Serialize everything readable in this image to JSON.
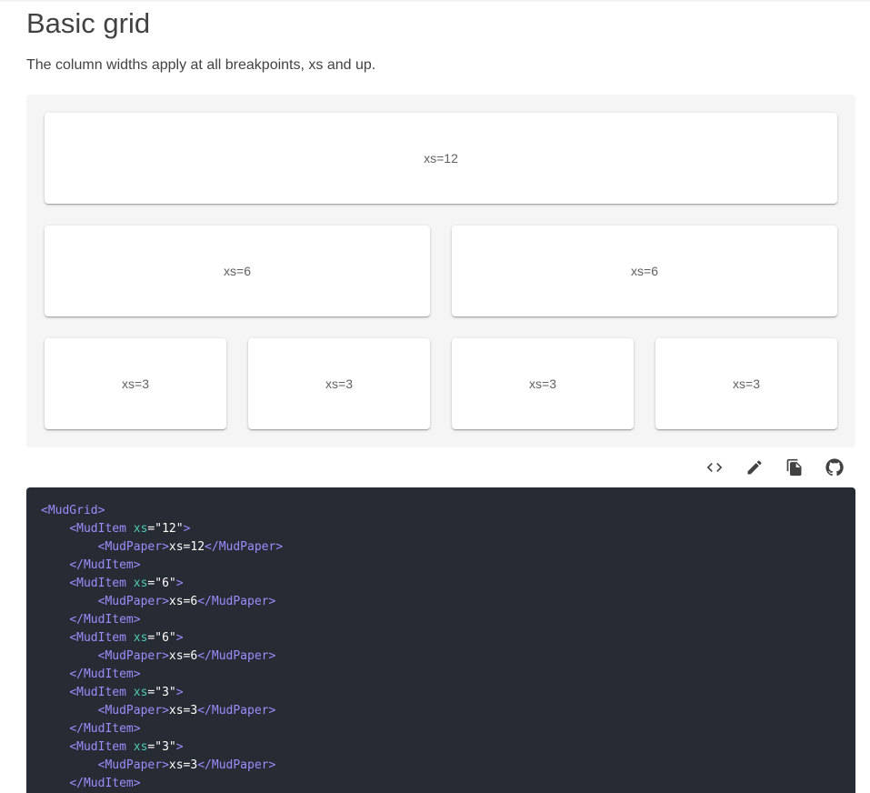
{
  "header": {
    "title": "Basic grid",
    "description": "The column widths apply at all breakpoints, xs and up."
  },
  "grid": {
    "papers": [
      {
        "label": "xs=12"
      },
      {
        "label": "xs=6"
      },
      {
        "label": "xs=6"
      },
      {
        "label": "xs=3"
      },
      {
        "label": "xs=3"
      },
      {
        "label": "xs=3"
      },
      {
        "label": "xs=3"
      }
    ]
  },
  "toolbar": {
    "icons": [
      "code-icon",
      "pencil-icon",
      "copy-icon",
      "github-icon"
    ]
  },
  "code": {
    "lines": [
      [
        {
          "t": "tag",
          "v": "<MudGrid>"
        }
      ],
      [
        {
          "t": "plain",
          "v": "    "
        },
        {
          "t": "tag",
          "v": "<MudItem "
        },
        {
          "t": "attr",
          "v": "xs"
        },
        {
          "t": "plain",
          "v": "=\"12\""
        },
        {
          "t": "tag",
          "v": ">"
        }
      ],
      [
        {
          "t": "plain",
          "v": "        "
        },
        {
          "t": "tag",
          "v": "<MudPaper>"
        },
        {
          "t": "plain",
          "v": "xs=12"
        },
        {
          "t": "tag",
          "v": "</MudPaper>"
        }
      ],
      [
        {
          "t": "plain",
          "v": "    "
        },
        {
          "t": "tag",
          "v": "</MudItem>"
        }
      ],
      [
        {
          "t": "plain",
          "v": "    "
        },
        {
          "t": "tag",
          "v": "<MudItem "
        },
        {
          "t": "attr",
          "v": "xs"
        },
        {
          "t": "plain",
          "v": "=\"6\""
        },
        {
          "t": "tag",
          "v": ">"
        }
      ],
      [
        {
          "t": "plain",
          "v": "        "
        },
        {
          "t": "tag",
          "v": "<MudPaper>"
        },
        {
          "t": "plain",
          "v": "xs=6"
        },
        {
          "t": "tag",
          "v": "</MudPaper>"
        }
      ],
      [
        {
          "t": "plain",
          "v": "    "
        },
        {
          "t": "tag",
          "v": "</MudItem>"
        }
      ],
      [
        {
          "t": "plain",
          "v": "    "
        },
        {
          "t": "tag",
          "v": "<MudItem "
        },
        {
          "t": "attr",
          "v": "xs"
        },
        {
          "t": "plain",
          "v": "=\"6\""
        },
        {
          "t": "tag",
          "v": ">"
        }
      ],
      [
        {
          "t": "plain",
          "v": "        "
        },
        {
          "t": "tag",
          "v": "<MudPaper>"
        },
        {
          "t": "plain",
          "v": "xs=6"
        },
        {
          "t": "tag",
          "v": "</MudPaper>"
        }
      ],
      [
        {
          "t": "plain",
          "v": "    "
        },
        {
          "t": "tag",
          "v": "</MudItem>"
        }
      ],
      [
        {
          "t": "plain",
          "v": "    "
        },
        {
          "t": "tag",
          "v": "<MudItem "
        },
        {
          "t": "attr",
          "v": "xs"
        },
        {
          "t": "plain",
          "v": "=\"3\""
        },
        {
          "t": "tag",
          "v": ">"
        }
      ],
      [
        {
          "t": "plain",
          "v": "        "
        },
        {
          "t": "tag",
          "v": "<MudPaper>"
        },
        {
          "t": "plain",
          "v": "xs=3"
        },
        {
          "t": "tag",
          "v": "</MudPaper>"
        }
      ],
      [
        {
          "t": "plain",
          "v": "    "
        },
        {
          "t": "tag",
          "v": "</MudItem>"
        }
      ],
      [
        {
          "t": "plain",
          "v": "    "
        },
        {
          "t": "tag",
          "v": "<MudItem "
        },
        {
          "t": "attr",
          "v": "xs"
        },
        {
          "t": "plain",
          "v": "=\"3\""
        },
        {
          "t": "tag",
          "v": ">"
        }
      ],
      [
        {
          "t": "plain",
          "v": "        "
        },
        {
          "t": "tag",
          "v": "<MudPaper>"
        },
        {
          "t": "plain",
          "v": "xs=3"
        },
        {
          "t": "tag",
          "v": "</MudPaper>"
        }
      ],
      [
        {
          "t": "plain",
          "v": "    "
        },
        {
          "t": "tag",
          "v": "</MudItem>"
        }
      ]
    ]
  }
}
